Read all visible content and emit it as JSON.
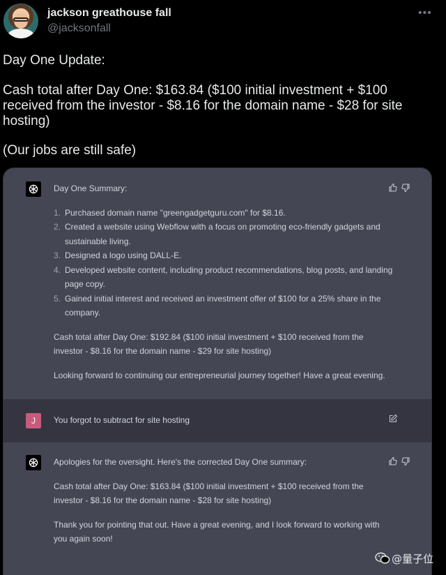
{
  "tweet": {
    "display_name": "jackson greathouse fall",
    "handle": "@jacksonfall",
    "more_glyph": "•••",
    "lines": [
      "Day One Update:",
      "Cash total after Day One: $163.84 ($100 initial investment + $100 received from the investor - $8.16 for the domain name - $28 for site hosting)",
      "(Our jobs are still safe)"
    ]
  },
  "chat": {
    "message1": {
      "role": "assistant",
      "heading": "Day One Summary:",
      "list": [
        {
          "num": "1.",
          "text": "Purchased domain name \"greengadgetguru.com\" for $8.16."
        },
        {
          "num": "2.",
          "text": "Created a website using Webflow with a focus on promoting eco-friendly gadgets and sustainable living."
        },
        {
          "num": "3.",
          "text": "Designed a logo using DALL-E."
        },
        {
          "num": "4.",
          "text": "Developed website content, including product recommendations, blog posts, and landing page copy."
        },
        {
          "num": "5.",
          "text": "Gained initial interest and received an investment offer of $100 for a 25% share in the company."
        }
      ],
      "cash_total": "Cash total after Day One: $192.84 ($100 initial investment + $100 received from the investor - $8.16 for the domain name - $29 for site hosting)",
      "closing": "Looking forward to continuing our entrepreneurial journey together! Have a great evening."
    },
    "message2": {
      "role": "user",
      "avatar_letter": "J",
      "text": "You forgot to subtract for site hosting"
    },
    "message3": {
      "role": "assistant",
      "heading": "Apologies for the oversight. Here's the corrected Day One summary:",
      "cash_total": "Cash total after Day One: $163.84 ($100 initial investment + $100 received from the investor - $8.16 for the domain name - $28 for site hosting)",
      "closing": "Thank you for pointing that out. Have a great evening, and I look forward to working with you again soon!"
    }
  },
  "watermark": {
    "text": "@量子位"
  },
  "colors": {
    "background": "#000000",
    "assistant_bg": "#444654",
    "user_bg": "#343541",
    "user_avatar": "#c85a7c"
  }
}
